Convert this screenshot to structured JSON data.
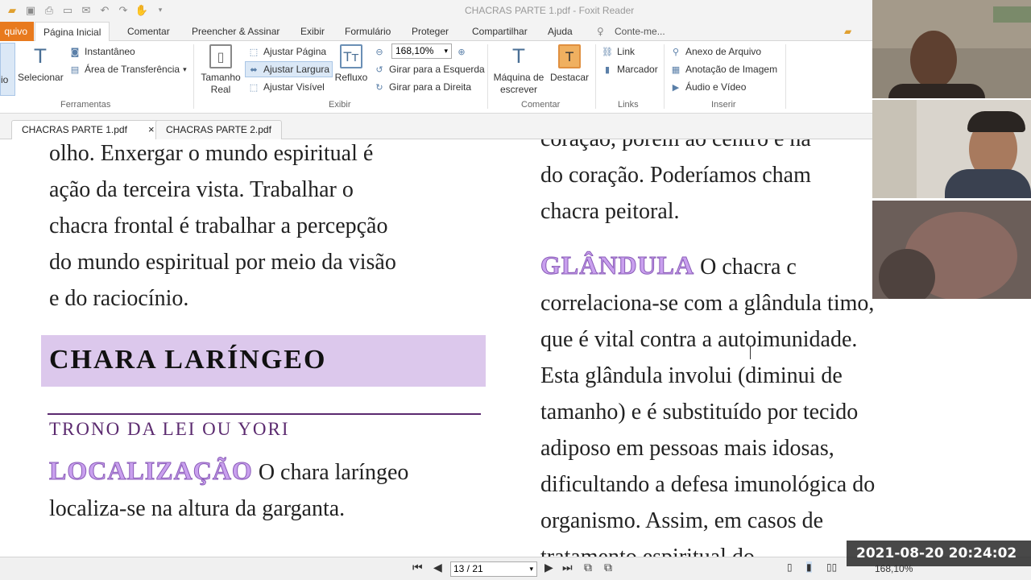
{
  "window": {
    "title": "CHACRAS PARTE 1.pdf - Foxit Reader"
  },
  "ribbon_tabs": [
    {
      "label": "quivo"
    },
    {
      "label": "Página Inicial"
    },
    {
      "label": "Comentar"
    },
    {
      "label": "Preencher & Assinar"
    },
    {
      "label": "Exibir"
    },
    {
      "label": "Formulário"
    },
    {
      "label": "Proteger"
    },
    {
      "label": "Compartilhar"
    },
    {
      "label": "Ajuda"
    },
    {
      "label": "Conte-me..."
    }
  ],
  "ribbon": {
    "groups": {
      "ferramentas": "Ferramentas",
      "exibir": "Exibir",
      "comentar": "Comentar",
      "links": "Links",
      "inserir": "Inserir"
    },
    "hand_label": "io",
    "selecionar": "Selecionar",
    "instantaneo": "Instantâneo",
    "area_transferencia": "Área de Transferência",
    "tamanho_real": "Tamanho Real",
    "ajustar_pagina": "Ajustar Página",
    "ajustar_largura": "Ajustar Largura",
    "ajustar_visivel": "Ajustar Visível",
    "refluxo": "Refluxo",
    "zoom_value": "168,10%",
    "girar_esquerda": "Girar para a Esquerda",
    "girar_direita": "Girar para a Direita",
    "maquina_escrever": "Máquina de escrever",
    "destacar": "Destacar",
    "link": "Link",
    "marcador": "Marcador",
    "anexo_arquivo": "Anexo de Arquivo",
    "anotacao_imagem": "Anotação de Imagem",
    "audio_video": "Áudio e Vídeo"
  },
  "doc_tabs": [
    {
      "label": "CHACRAS PARTE 1.pdf",
      "close": "×"
    },
    {
      "label": "CHACRAS PARTE 2.pdf"
    }
  ],
  "content": {
    "left_lines": [
      "olho. Enxergar o mundo espiritual é",
      "ação da terceira vista. Trabalhar o",
      "chacra frontal é trabalhar a percepção",
      "do mundo espiritual por meio da visão",
      "e do raciocínio."
    ],
    "heading": "CHARA LARÍNGEO",
    "subheading": "TRONO DA LEI OU YORI",
    "localizacao_kw": "LOCALIZAÇÃO",
    "localizacao_text_1": " O chara laríngeo",
    "localizacao_text_2": "localiza-se na altura da garganta.",
    "right_top_lines": [
      "coração, porém ao centro e na",
      "do coração. Poderíamos cham",
      "chacra peitoral."
    ],
    "glandula_kw": "GLÂNDULA",
    "glandula_text_1": " O chacra c",
    "right_lines": [
      "correlaciona-se com a glândula timo,",
      "que é vital contra a autoimunidade.",
      "Esta glândula involui (diminui de",
      "tamanho) e é substituído por tecido",
      "adiposo em pessoas mais idosas,",
      "dificultando a defesa imunológica do",
      "organismo. Assim, em casos de",
      "tratamento espiritual do"
    ]
  },
  "status": {
    "page_indicator": "13 / 21",
    "zoom": "168,10%",
    "timestamp": "2021-08-20 20:24:02"
  },
  "colors": {
    "accent_orange": "#e87a1e",
    "heading_bg": "#dcc8ec",
    "purple": "#5b2a6f",
    "keyword": "#c9a0ee"
  }
}
